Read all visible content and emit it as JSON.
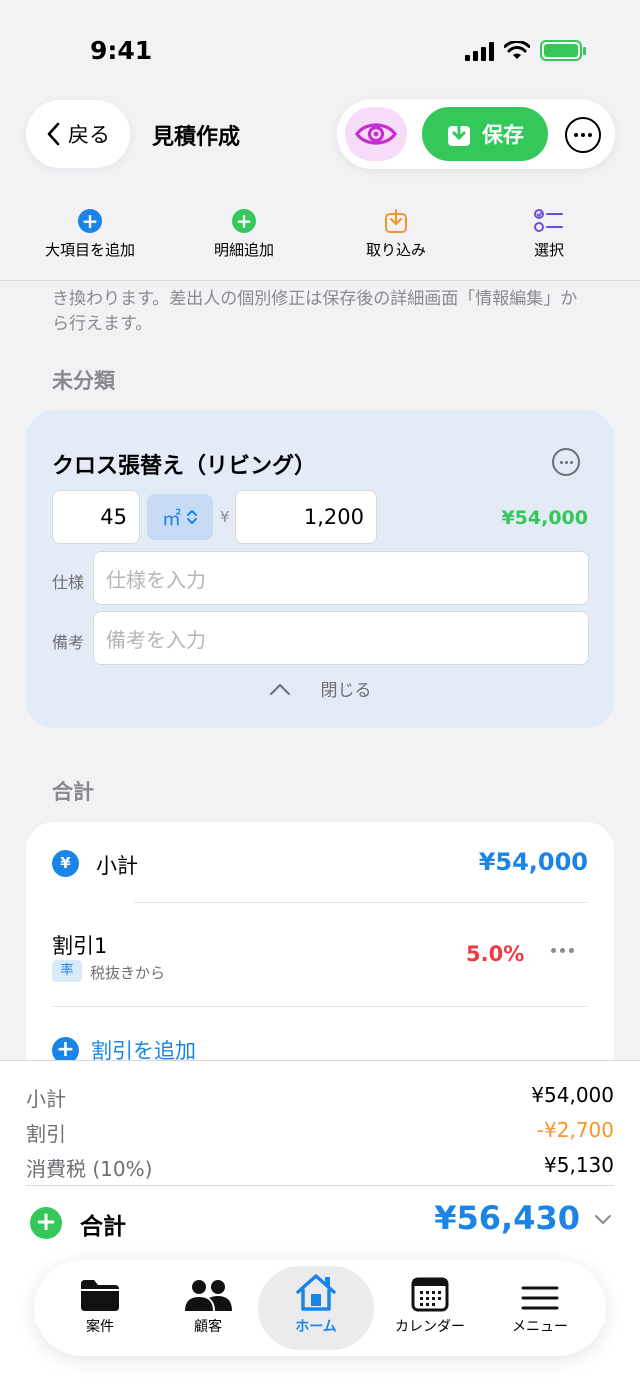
{
  "status_bar": {
    "time": "9:41"
  },
  "nav": {
    "back_label": "戻る",
    "title": "見積作成",
    "save_label": "保存"
  },
  "toolbar": {
    "add_major_label": "大項目を追加",
    "add_detail_label": "明細追加",
    "import_label": "取り込み",
    "select_label": "選択"
  },
  "notice_text": "き換わります。差出人の個別修正は保存後の詳細画面「情報編集」から行えます。",
  "uncategorized": {
    "heading": "未分類",
    "item": {
      "title": "クロス張替え（リビング）",
      "quantity": "45",
      "unit": "㎡",
      "currency_symbol": "¥",
      "unit_price": "1,200",
      "amount": "¥54,000",
      "spec_label": "仕様",
      "spec_placeholder": "仕様を入力",
      "note_label": "備考",
      "note_placeholder": "備考を入力",
      "collapse_label": "閉じる"
    }
  },
  "totals_section": {
    "heading": "合計",
    "subtotal_label": "小計",
    "subtotal_value": "¥54,000",
    "discount": {
      "label": "割引1",
      "badge": "率",
      "basis": "税抜きから",
      "value": "5.0%"
    },
    "add_discount_label": "割引を追加"
  },
  "summary": {
    "subtotal_label": "小計",
    "subtotal_value": "¥54,000",
    "discount_label": "割引",
    "discount_value": "-¥2,700",
    "tax_label": "消費税 (10%)",
    "tax_value": "¥5,130",
    "grand_label": "合計",
    "grand_value": "¥56,430"
  },
  "tabbar": {
    "items": [
      {
        "label": "案件",
        "icon": "folder-icon"
      },
      {
        "label": "顧客",
        "icon": "people-icon"
      },
      {
        "label": "ホーム",
        "icon": "house-icon"
      },
      {
        "label": "カレンダー",
        "icon": "calendar-icon"
      },
      {
        "label": "メニュー",
        "icon": "menu-icon"
      }
    ],
    "active": "ホーム"
  },
  "colors": {
    "accent_blue": "#1a85e6",
    "green": "#34c759",
    "red": "#ee3b45",
    "orange": "#f5952a",
    "purple": "#c32fd0"
  }
}
